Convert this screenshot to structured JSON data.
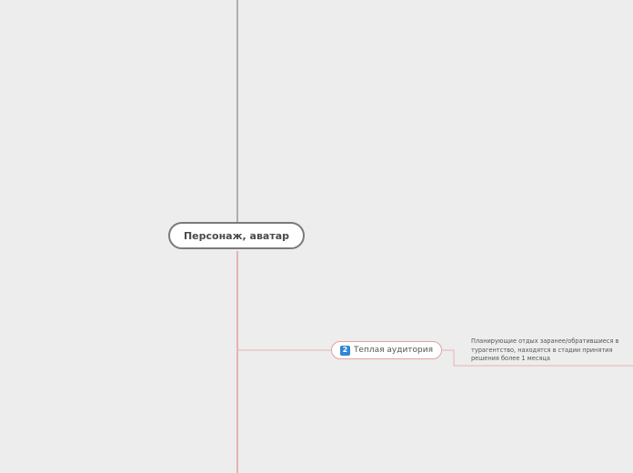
{
  "mindmap": {
    "central_topic": {
      "label": "Персонаж, аватар",
      "border_color": "#7a7a7a"
    },
    "branches": [
      {
        "number": "2",
        "label": "Теплая аудитория",
        "badge_color": "#2f86d6",
        "branch_color": "#e2a3a3",
        "note": "Планирующие отдых заранее/обратившиеся в турагентство, находятся в стадии принятия решения более 1 месяца"
      }
    ]
  },
  "colors": {
    "background": "#ededed",
    "upper_connector": "#9a9a9a",
    "lower_connector": "#e0a0a0"
  }
}
